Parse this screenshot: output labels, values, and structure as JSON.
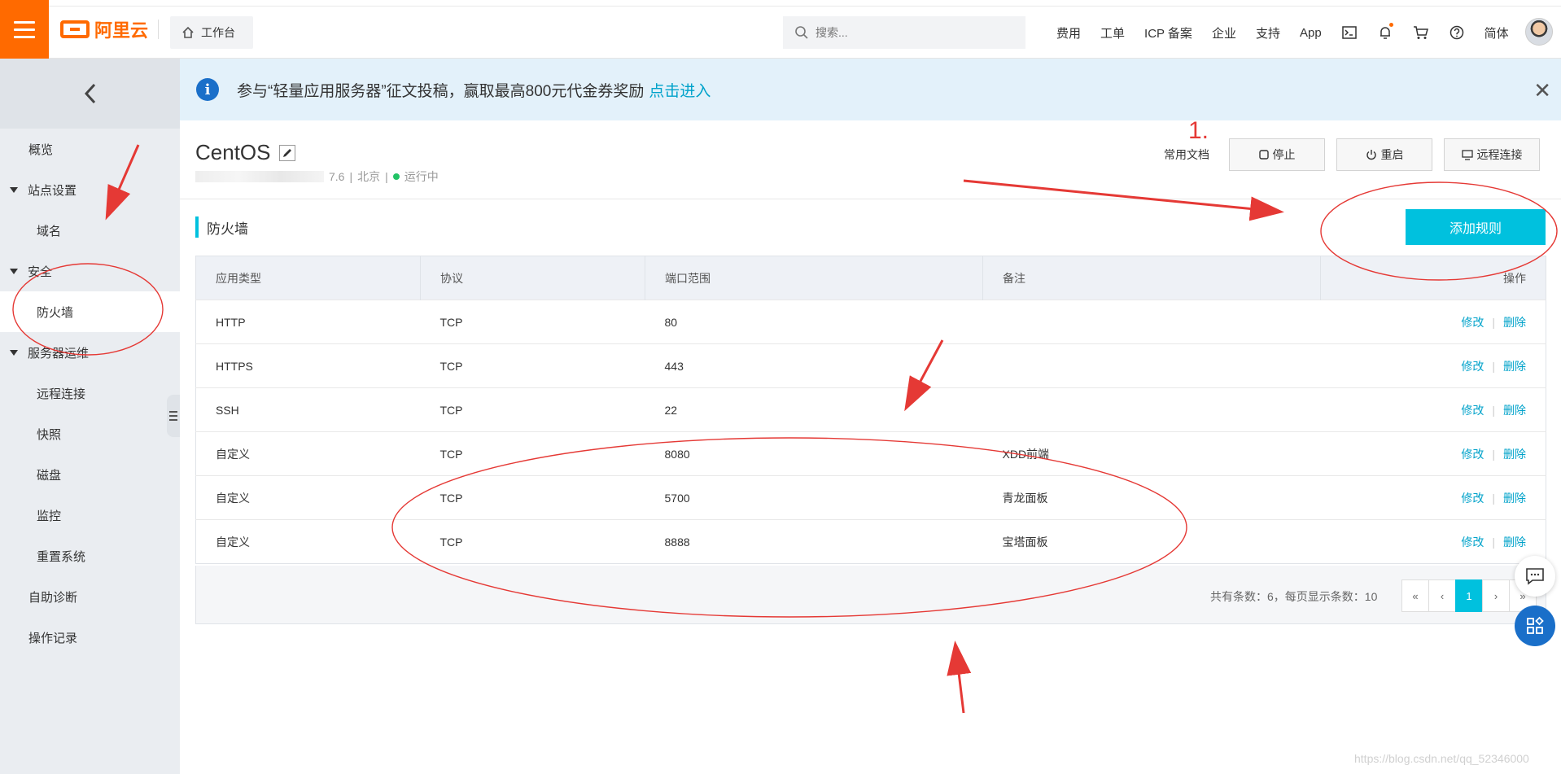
{
  "topbar": {
    "brand": "阿里云",
    "workbench_label": "工作台",
    "search_placeholder": "搜索...",
    "nav": [
      "费用",
      "工单",
      "ICP 备案",
      "企业",
      "支持",
      "App"
    ],
    "lang_label": "简体",
    "icons": [
      "terminal-icon",
      "bell-icon",
      "cart-icon",
      "help-icon"
    ]
  },
  "sidebar": {
    "items": [
      {
        "label": "概览",
        "type": "item"
      },
      {
        "label": "站点设置",
        "type": "group"
      },
      {
        "label": "域名",
        "type": "sub"
      },
      {
        "label": "安全",
        "type": "group"
      },
      {
        "label": "防火墙",
        "type": "sub",
        "active": true
      },
      {
        "label": "服务器运维",
        "type": "group"
      },
      {
        "label": "远程连接",
        "type": "sub"
      },
      {
        "label": "快照",
        "type": "sub"
      },
      {
        "label": "磁盘",
        "type": "sub"
      },
      {
        "label": "监控",
        "type": "sub"
      },
      {
        "label": "重置系统",
        "type": "sub"
      },
      {
        "label": "自助诊断",
        "type": "item"
      },
      {
        "label": "操作记录",
        "type": "item"
      }
    ]
  },
  "banner": {
    "text": "参与“轻量应用服务器”征文投稿，赢取最高800元代金券奖励",
    "link": "点击进入"
  },
  "instance": {
    "name": "CentOS",
    "version": "7.6",
    "region": "北京",
    "status": "运行中"
  },
  "actions": {
    "docs": "常用文档",
    "stop": "停止",
    "restart": "重启",
    "remote": "远程连接"
  },
  "firewall": {
    "title": "防火墙",
    "add_button": "添加规则",
    "columns": [
      "应用类型",
      "协议",
      "端口范围",
      "备注",
      "操作"
    ],
    "rows": [
      {
        "app": "HTTP",
        "protocol": "TCP",
        "port": "80",
        "note": ""
      },
      {
        "app": "HTTPS",
        "protocol": "TCP",
        "port": "443",
        "note": ""
      },
      {
        "app": "SSH",
        "protocol": "TCP",
        "port": "22",
        "note": ""
      },
      {
        "app": "自定义",
        "protocol": "TCP",
        "port": "8080",
        "note": "XDD前端"
      },
      {
        "app": "自定义",
        "protocol": "TCP",
        "port": "5700",
        "note": "青龙面板"
      },
      {
        "app": "自定义",
        "protocol": "TCP",
        "port": "8888",
        "note": "宝塔面板"
      }
    ],
    "op_edit": "修改",
    "op_delete": "删除",
    "pager_text": "共有条数：6，每页显示条数：10",
    "pages": [
      "«",
      "‹",
      "1",
      "›",
      "»"
    ],
    "current_page": "1"
  },
  "annotation": {
    "label": "1."
  },
  "watermark": "https://blog.csdn.net/qq_52346000",
  "colors": {
    "accent": "#00c1de",
    "brand": "#ff6a00",
    "link": "#00a2ca",
    "annotation": "#e53935"
  }
}
